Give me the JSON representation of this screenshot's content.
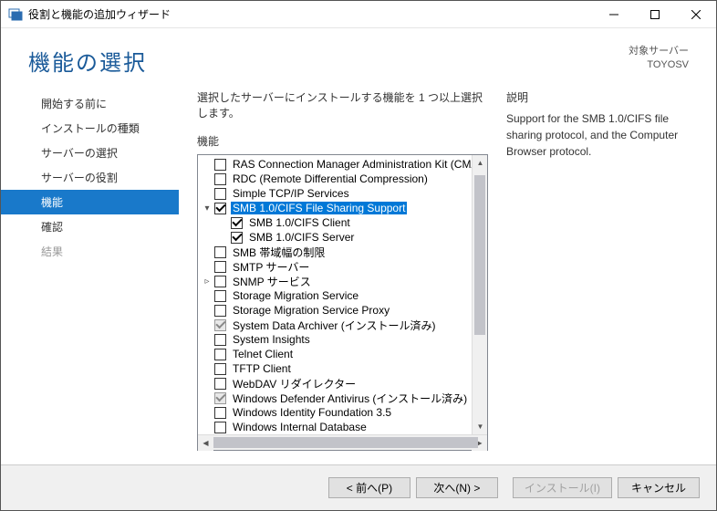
{
  "window": {
    "title": "役割と機能の追加ウィザード"
  },
  "header": {
    "page_title": "機能の選択",
    "target_label": "対象サーバー",
    "target_value": "TOYOSV"
  },
  "sidebar": {
    "items": [
      {
        "label": "開始する前に",
        "state": "normal"
      },
      {
        "label": "インストールの種類",
        "state": "normal"
      },
      {
        "label": "サーバーの選択",
        "state": "normal"
      },
      {
        "label": "サーバーの役割",
        "state": "normal"
      },
      {
        "label": "機能",
        "state": "active"
      },
      {
        "label": "確認",
        "state": "normal"
      },
      {
        "label": "結果",
        "state": "disabled"
      }
    ]
  },
  "main": {
    "instruction": "選択したサーバーにインストールする機能を 1 つ以上選択します。",
    "features_heading": "機能",
    "description_heading": "説明",
    "description_text": "Support for the SMB 1.0/CIFS file sharing protocol, and the Computer Browser protocol."
  },
  "tree": [
    {
      "depth": 0,
      "expander": "",
      "checked": false,
      "label": "RAS Connection Manager Administration Kit (CMA",
      "selected": false
    },
    {
      "depth": 0,
      "expander": "",
      "checked": false,
      "label": "RDC (Remote Differential Compression)",
      "selected": false
    },
    {
      "depth": 0,
      "expander": "",
      "checked": false,
      "label": "Simple TCP/IP Services",
      "selected": false
    },
    {
      "depth": 0,
      "expander": "▾",
      "checked": true,
      "label": "SMB 1.0/CIFS File Sharing Support",
      "selected": true
    },
    {
      "depth": 1,
      "expander": "",
      "checked": true,
      "label": "SMB 1.0/CIFS Client",
      "selected": false
    },
    {
      "depth": 1,
      "expander": "",
      "checked": true,
      "label": "SMB 1.0/CIFS Server",
      "selected": false
    },
    {
      "depth": 0,
      "expander": "",
      "checked": false,
      "label": "SMB 帯域幅の制限",
      "selected": false
    },
    {
      "depth": 0,
      "expander": "",
      "checked": false,
      "label": "SMTP サーバー",
      "selected": false
    },
    {
      "depth": 0,
      "expander": "▹",
      "checked": false,
      "label": "SNMP サービス",
      "selected": false
    },
    {
      "depth": 0,
      "expander": "",
      "checked": false,
      "label": "Storage Migration Service",
      "selected": false
    },
    {
      "depth": 0,
      "expander": "",
      "checked": false,
      "label": "Storage Migration Service Proxy",
      "selected": false
    },
    {
      "depth": 0,
      "expander": "",
      "checked": "dim",
      "label": "System Data Archiver (インストール済み)",
      "selected": false
    },
    {
      "depth": 0,
      "expander": "",
      "checked": false,
      "label": "System Insights",
      "selected": false
    },
    {
      "depth": 0,
      "expander": "",
      "checked": false,
      "label": "Telnet Client",
      "selected": false
    },
    {
      "depth": 0,
      "expander": "",
      "checked": false,
      "label": "TFTP Client",
      "selected": false
    },
    {
      "depth": 0,
      "expander": "",
      "checked": false,
      "label": "WebDAV リダイレクター",
      "selected": false
    },
    {
      "depth": 0,
      "expander": "",
      "checked": "dim",
      "label": "Windows Defender Antivirus (インストール済み)",
      "selected": false
    },
    {
      "depth": 0,
      "expander": "",
      "checked": false,
      "label": "Windows Identity Foundation 3.5",
      "selected": false
    },
    {
      "depth": 0,
      "expander": "",
      "checked": false,
      "label": "Windows Internal Database",
      "selected": false
    }
  ],
  "footer": {
    "prev": "< 前へ(P)",
    "next": "次へ(N) >",
    "install": "インストール(I)",
    "cancel": "キャンセル"
  }
}
